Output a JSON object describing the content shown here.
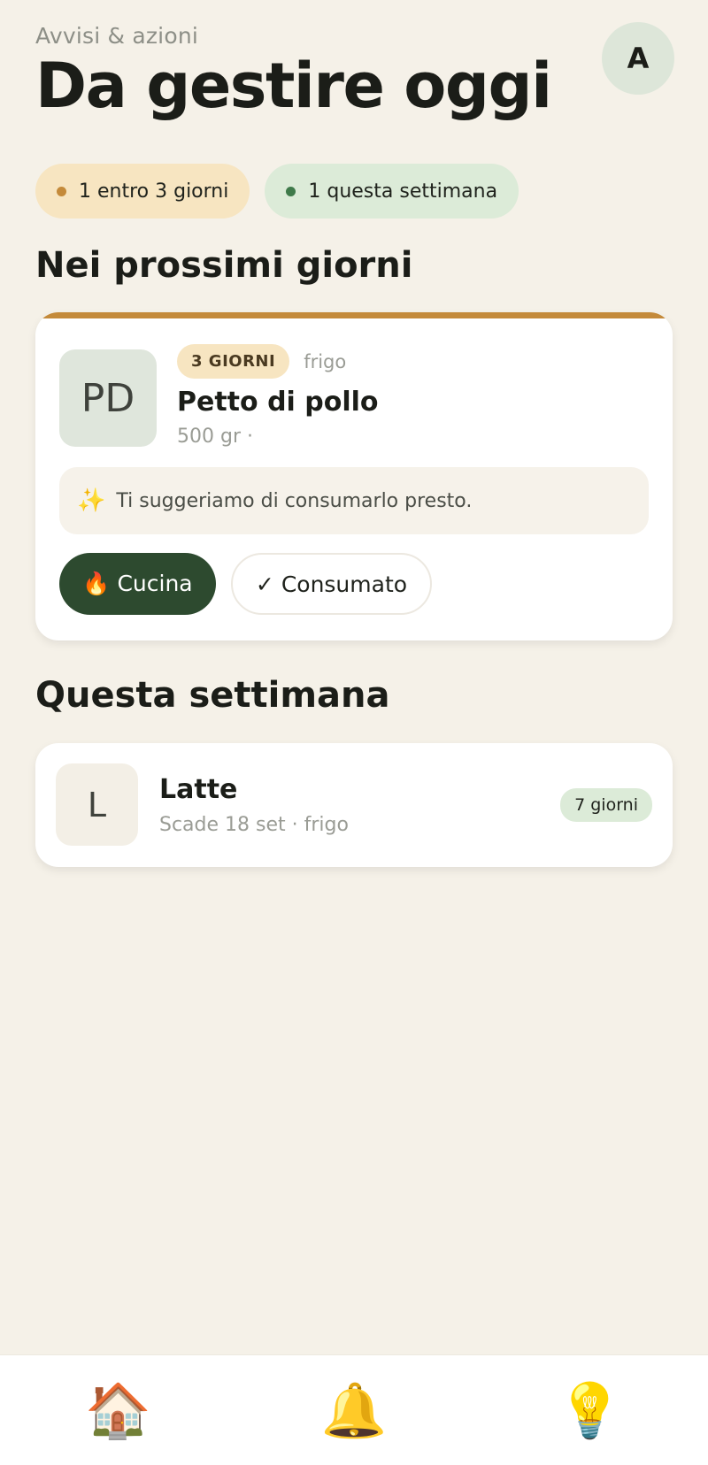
{
  "header": {
    "eyebrow": "Avvisi & azioni",
    "title": "Da gestire oggi",
    "avatar_initial": "A"
  },
  "summary_pills": [
    {
      "label": "1 entro 3 giorni",
      "dot_color": "#c48a3a"
    },
    {
      "label": "1 questa settimana",
      "dot_color": "#3f7a4a"
    }
  ],
  "sections": {
    "upcoming_title": "Nei prossimi giorni",
    "week_title": "Questa settimana"
  },
  "urgent_item": {
    "initials": "PD",
    "days_badge": "3 GIORNI",
    "location": "frigo",
    "name": "Petto di pollo",
    "quantity": "500 gr ·",
    "hint_icon": "✨",
    "hint": "Ti suggeriamo di consumarlo presto.",
    "cook_label": "🔥 Cucina",
    "consumed_label": "✓ Consumato"
  },
  "week_item": {
    "initial": "L",
    "name": "Latte",
    "meta": "Scade 18 set · frigo",
    "days": "7 giorni"
  },
  "tabbar": [
    {
      "icon": "🏠",
      "name": "home-icon"
    },
    {
      "icon": "🔔",
      "name": "bell-icon"
    },
    {
      "icon": "💡",
      "name": "lightbulb-icon"
    }
  ]
}
